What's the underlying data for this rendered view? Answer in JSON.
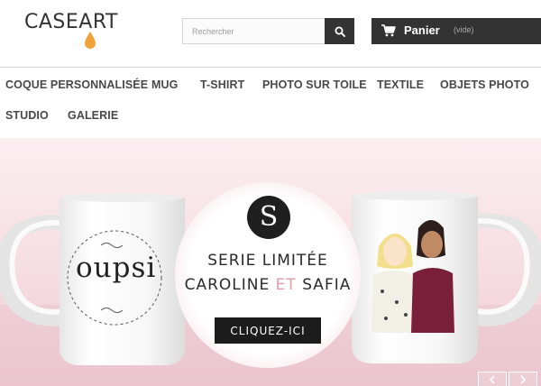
{
  "brand": {
    "logo_part1": "CASE",
    "logo_part2": "ART"
  },
  "search": {
    "placeholder": "Rechercher",
    "icon": "search-icon"
  },
  "cart": {
    "label": "Panier",
    "status": "(vide)",
    "icon": "cart-icon"
  },
  "nav": {
    "items": [
      {
        "label": "COQUE PERSONNALISÉE"
      },
      {
        "label": "MUG"
      },
      {
        "label": "T-SHIRT"
      },
      {
        "label": "PHOTO SUR TOILE"
      },
      {
        "label": "TEXTILE"
      },
      {
        "label": "OBJETS PHOTO"
      },
      {
        "label": "STUDIO"
      },
      {
        "label": "GALERIE"
      }
    ]
  },
  "banner": {
    "left_mug_text": "oupsi",
    "badge_monogram": "S",
    "line1": "SERIE LIMITÉE",
    "line2_a": "CAROLINE",
    "line2_et": "ET",
    "line2_b": "SAFIA",
    "cta_label": "CLIQUEZ-ICI",
    "prev_icon": "chevron-left-icon",
    "next_icon": "chevron-right-icon"
  },
  "colors": {
    "accent_drop": "#f0a33a",
    "dark": "#333333",
    "banner_pink": "#f6dde2",
    "et_pink": "#e99aa9"
  }
}
